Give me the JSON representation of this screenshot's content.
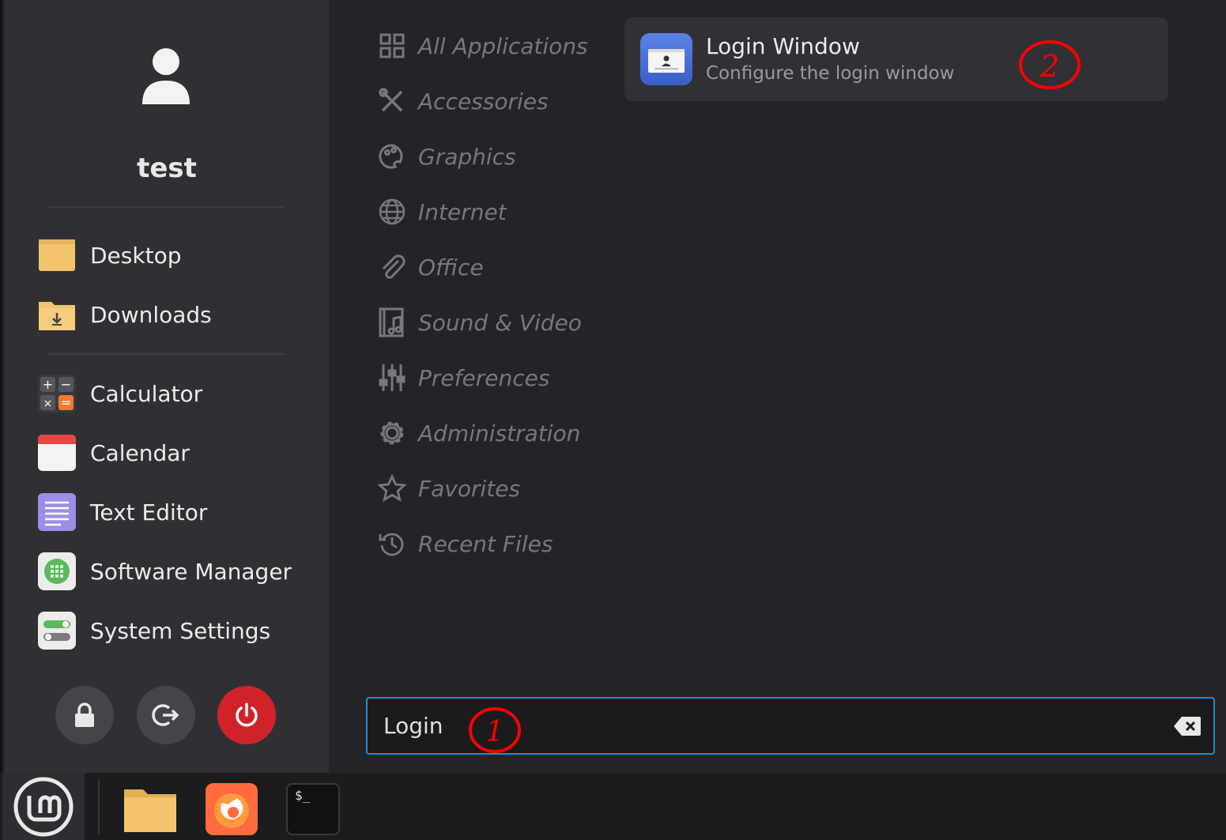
{
  "user": {
    "name": "test"
  },
  "places": [
    {
      "label": "Desktop",
      "icon": "folder-icon"
    },
    {
      "label": "Downloads",
      "icon": "folder-download-icon"
    }
  ],
  "favorites": [
    {
      "label": "Calculator",
      "icon": "calculator-icon"
    },
    {
      "label": "Calendar",
      "icon": "calendar-icon"
    },
    {
      "label": "Text Editor",
      "icon": "text-editor-icon"
    },
    {
      "label": "Software Manager",
      "icon": "software-manager-icon"
    },
    {
      "label": "System Settings",
      "icon": "system-settings-icon"
    }
  ],
  "session_buttons": [
    "lock-icon",
    "logout-icon",
    "power-icon"
  ],
  "categories": [
    {
      "label": "All Applications",
      "icon": "grid-icon"
    },
    {
      "label": "Accessories",
      "icon": "tools-icon"
    },
    {
      "label": "Graphics",
      "icon": "palette-icon"
    },
    {
      "label": "Internet",
      "icon": "globe-icon"
    },
    {
      "label": "Office",
      "icon": "paperclip-icon"
    },
    {
      "label": "Sound & Video",
      "icon": "film-music-icon"
    },
    {
      "label": "Preferences",
      "icon": "sliders-icon"
    },
    {
      "label": "Administration",
      "icon": "gear-icon"
    },
    {
      "label": "Favorites",
      "icon": "star-icon"
    },
    {
      "label": "Recent Files",
      "icon": "history-icon"
    }
  ],
  "result": {
    "title": "Login Window",
    "description": "Configure the login window",
    "icon": "login-window-icon"
  },
  "search": {
    "value": "Login "
  },
  "annotations": [
    "1",
    "2"
  ],
  "taskbar": {
    "apps": [
      "files-icon",
      "firefox-icon",
      "terminal-icon"
    ],
    "terminal_prompt": "$_"
  },
  "colors": {
    "accent": "#2a8bc6",
    "power": "#d0222a",
    "annotation": "#ff0000",
    "folder": "#f2c46d"
  }
}
